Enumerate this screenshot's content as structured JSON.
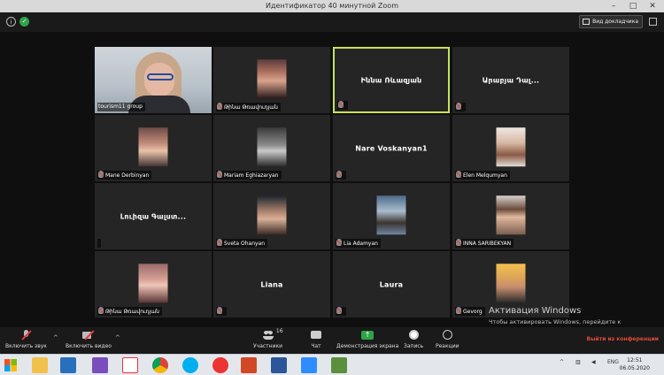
{
  "window": {
    "title": "Идентификатор 40 минутной Zoom"
  },
  "topbar": {
    "view_label": "Вид докладчика"
  },
  "participants": [
    {
      "name": "tourism11 group",
      "muted": false,
      "kind": "host-video"
    },
    {
      "name": "Թինա Թռավուդյան",
      "muted": true,
      "kind": "photo",
      "photo": "ph-a"
    },
    {
      "name": "Իննա Ռևազյան",
      "muted": true,
      "kind": "name-only",
      "active": true
    },
    {
      "name": "Արաբյա Դալ...",
      "muted": true,
      "kind": "name-only"
    },
    {
      "name": "Mane Derbinyan",
      "muted": true,
      "kind": "photo",
      "photo": "ph-b"
    },
    {
      "name": "Mariam Eghiazaryan",
      "muted": true,
      "kind": "photo",
      "photo": "ph-c"
    },
    {
      "name": "Nare Voskanyan1",
      "muted": true,
      "kind": "name-only"
    },
    {
      "name": "Elen Melqumyan",
      "muted": true,
      "kind": "photo",
      "photo": "ph-d"
    },
    {
      "name": "Լուիզա Գալստ...",
      "muted": false,
      "kind": "name-only"
    },
    {
      "name": "Sveta Ohanyan",
      "muted": true,
      "kind": "photo",
      "photo": "ph-e"
    },
    {
      "name": "Lia Adamyan",
      "muted": true,
      "kind": "photo",
      "photo": "ph-f"
    },
    {
      "name": "INNA SARIBEKYAN",
      "muted": true,
      "kind": "photo",
      "photo": "ph-g"
    },
    {
      "name": "Թինա Թռավուդյան",
      "muted": true,
      "kind": "photo",
      "photo": "ph-h"
    },
    {
      "name": "Liana",
      "muted": true,
      "kind": "name-only"
    },
    {
      "name": "Laura",
      "muted": true,
      "kind": "name-only"
    },
    {
      "name": "Gevorg",
      "muted": true,
      "kind": "photo",
      "photo": "ph-i"
    }
  ],
  "controls": {
    "audio_label": "Включить звук",
    "video_label": "Включить видео",
    "participants_label": "Участники",
    "participants_count": "16",
    "chat_label": "Чат",
    "share_label": "Демонстрация экрана",
    "record_label": "Запись",
    "reactions_label": "Реакции",
    "leave_label": "Выйти из конференции"
  },
  "activation": {
    "title": "Активация Windows",
    "body": "Чтобы активировать Windows, перейдите к параметрам компьютера."
  },
  "taskbar": {
    "lang": "ENG",
    "time": "12:51",
    "date": "06.05.2020"
  },
  "colors": {
    "active_speaker_border": "#c7e35a",
    "share_green": "#2ea34a",
    "leave_red": "#e04a3a"
  }
}
